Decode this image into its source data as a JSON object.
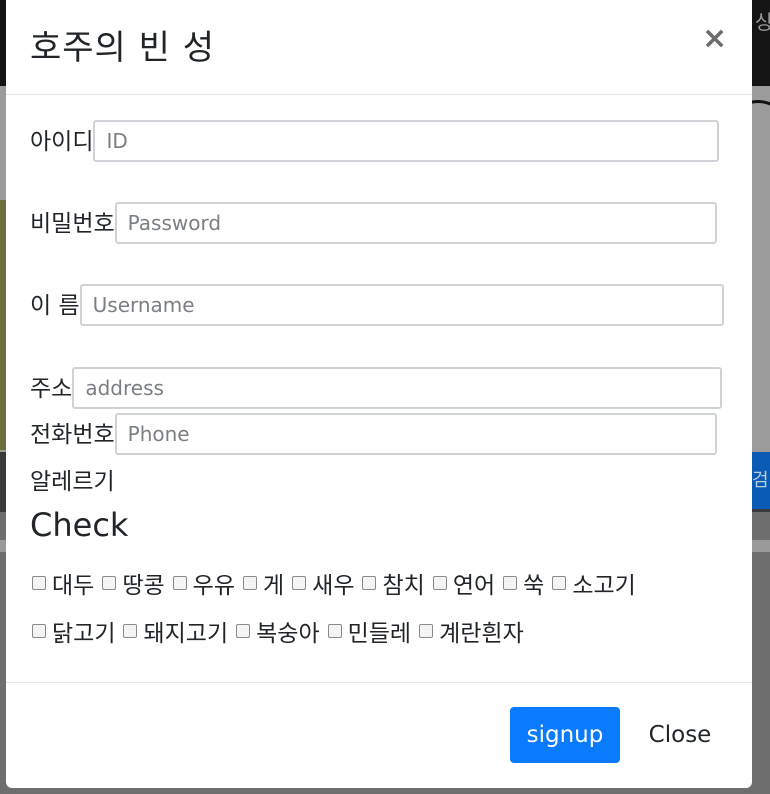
{
  "background": {
    "top_right_text": "상",
    "blue_button_text": "검"
  },
  "modal": {
    "title": "호주의 빈 성",
    "close_icon": "×",
    "fields": [
      {
        "label": "아이디",
        "placeholder": "ID"
      },
      {
        "label": "비밀번호",
        "placeholder": "Password"
      },
      {
        "label": "이 름",
        "placeholder": "Username"
      },
      {
        "label": "주소",
        "placeholder": "address"
      },
      {
        "label": "전화번호",
        "placeholder": "Phone"
      }
    ],
    "alert_label": "알레르기",
    "check_title": "Check",
    "check_row1": [
      "대두",
      "땅콩",
      "우유",
      "게",
      "새우",
      "참치",
      "연어",
      "쑥",
      "소고기"
    ],
    "check_row2": [
      "닭고기",
      "돼지고기",
      "복숭아",
      "민들레",
      "계란흰자"
    ],
    "signup_label": "signup",
    "close_label": "Close"
  }
}
